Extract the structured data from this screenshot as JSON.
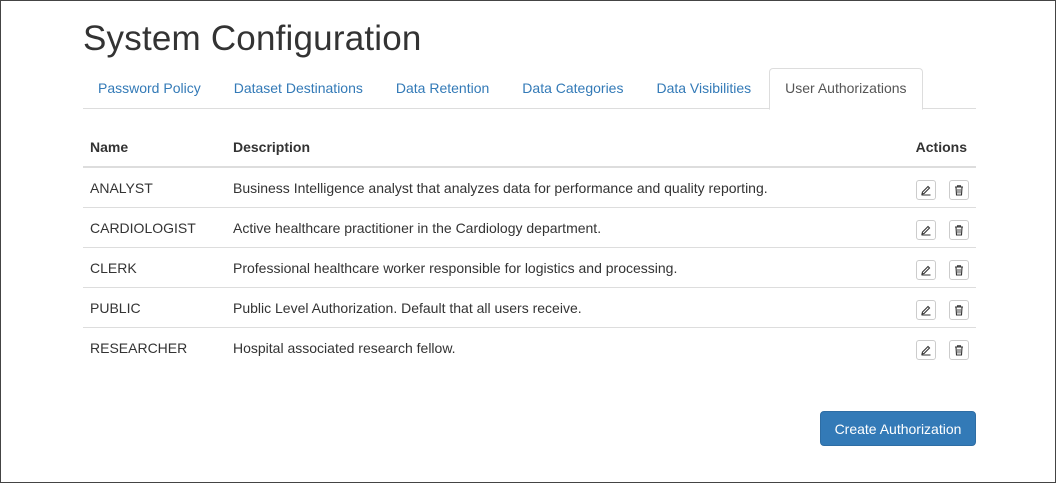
{
  "page": {
    "title": "System Configuration"
  },
  "tabs": [
    {
      "label": "Password Policy",
      "active": false
    },
    {
      "label": "Dataset Destinations",
      "active": false
    },
    {
      "label": "Data Retention",
      "active": false
    },
    {
      "label": "Data Categories",
      "active": false
    },
    {
      "label": "Data Visibilities",
      "active": false
    },
    {
      "label": "User Authorizations",
      "active": true
    }
  ],
  "table": {
    "headers": {
      "name": "Name",
      "description": "Description",
      "actions": "Actions"
    },
    "rows": [
      {
        "name": "ANALYST",
        "description": "Business Intelligence analyst that analyzes data for performance and quality reporting."
      },
      {
        "name": "CARDIOLOGIST",
        "description": "Active healthcare practitioner in the Cardiology department."
      },
      {
        "name": "CLERK",
        "description": "Professional healthcare worker responsible for logistics and processing."
      },
      {
        "name": "PUBLIC",
        "description": "Public Level Authorization. Default that all users receive."
      },
      {
        "name": "RESEARCHER",
        "description": "Hospital associated research fellow."
      }
    ],
    "row_actions": {
      "edit_icon": "edit-icon",
      "delete_icon": "trash-icon"
    }
  },
  "buttons": {
    "create_label": "Create Authorization"
  },
  "colors": {
    "accent": "#337ab7",
    "link": "#337ab7",
    "border": "#dddddd",
    "text": "#333333"
  }
}
